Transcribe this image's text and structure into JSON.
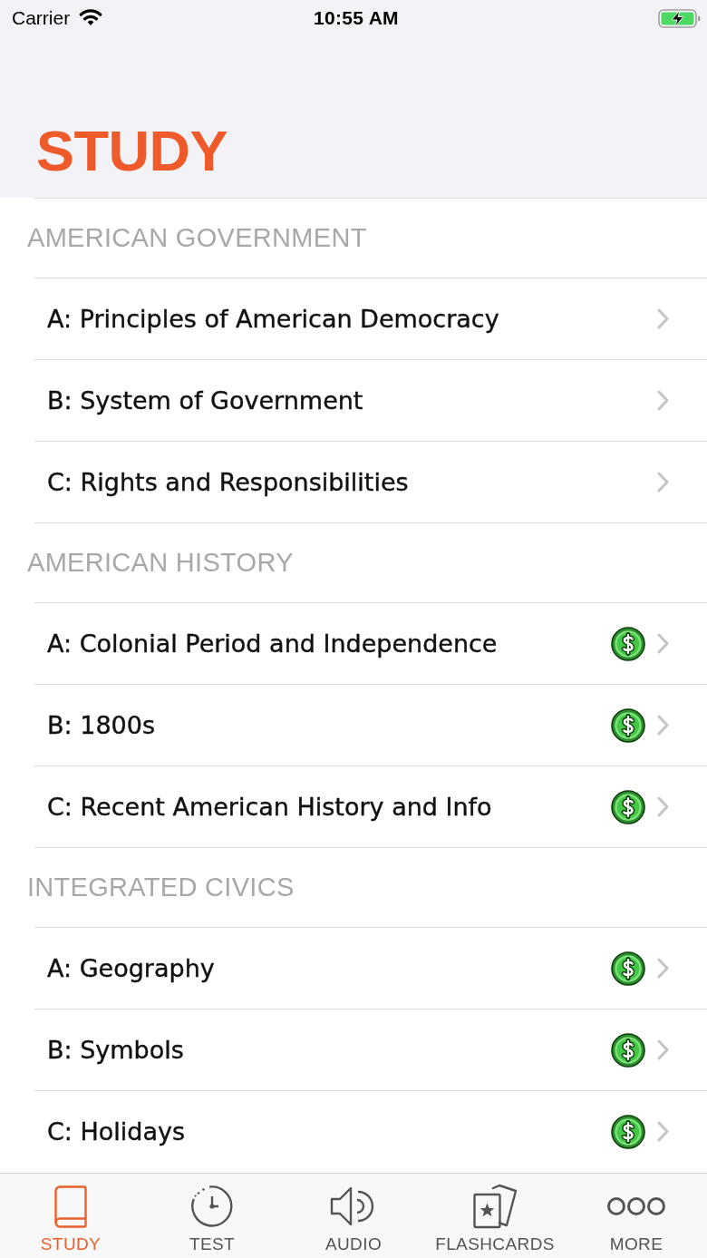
{
  "status_bar": {
    "carrier": "Carrier",
    "time": "10:55 AM",
    "charging": true
  },
  "header": {
    "title": "STUDY"
  },
  "sections": [
    {
      "title": "AMERICAN GOVERNMENT",
      "rows": [
        {
          "label": "A: Principles of American Democracy",
          "premium": false
        },
        {
          "label": "B: System of Government",
          "premium": false
        },
        {
          "label": "C: Rights and Responsibilities",
          "premium": false
        }
      ]
    },
    {
      "title": "AMERICAN HISTORY",
      "rows": [
        {
          "label": "A: Colonial Period and Independence",
          "premium": true
        },
        {
          "label": "B: 1800s",
          "premium": true
        },
        {
          "label": "C: Recent American History and Info",
          "premium": true
        }
      ]
    },
    {
      "title": "INTEGRATED CIVICS",
      "rows": [
        {
          "label": "A: Geography",
          "premium": true
        },
        {
          "label": "B: Symbols",
          "premium": true
        },
        {
          "label": "C: Holidays",
          "premium": true
        }
      ]
    }
  ],
  "tab_bar": [
    {
      "label": "STUDY",
      "kind": "book",
      "selected": true
    },
    {
      "label": "TEST",
      "kind": "clock",
      "selected": false
    },
    {
      "label": "AUDIO",
      "kind": "speaker",
      "selected": false
    },
    {
      "label": "FLASHCARDS",
      "kind": "cards",
      "selected": false
    },
    {
      "label": "MORE",
      "kind": "dots",
      "selected": false
    }
  ]
}
